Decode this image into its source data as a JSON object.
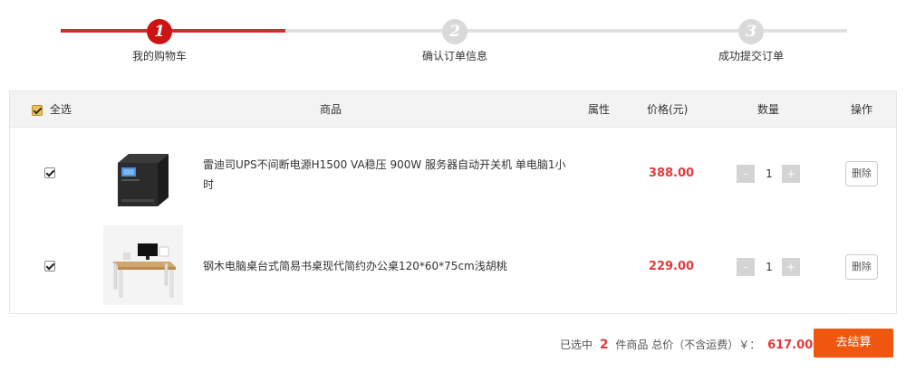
{
  "steps": [
    {
      "number": "1",
      "label": "我的购物车"
    },
    {
      "number": "2",
      "label": "确认订单信息"
    },
    {
      "number": "3",
      "label": "成功提交订单"
    }
  ],
  "table_header": {
    "select_all": "全选",
    "product": "商品",
    "attribute": "属性",
    "price": "价格(元)",
    "quantity": "数量",
    "action": "操作"
  },
  "items": [
    {
      "name": "雷迪司UPS不间断电源H1500 VA稳压 900W 服务器自动开关机 单电脑1小时",
      "price": "388.00",
      "quantity": "1",
      "minus": "-",
      "plus": "+",
      "delete_label": "删除",
      "checked": true,
      "image_icon": "ups-device-image"
    },
    {
      "name": "钢木电脑桌台式简易书桌现代简约办公桌120*60*75cm浅胡桃",
      "price": "229.00",
      "quantity": "1",
      "minus": "-",
      "plus": "+",
      "delete_label": "删除",
      "checked": true,
      "image_icon": "desk-image"
    }
  ],
  "summary": {
    "prefix": "已选中",
    "count": "2",
    "middle": "件商品 总价（不含运费）￥：",
    "total": "617.00"
  },
  "checkout_label": "去结算",
  "colors": {
    "accent_red": "#cc1414",
    "price_red": "#e4393c",
    "checkout_orange": "#f0570e"
  }
}
